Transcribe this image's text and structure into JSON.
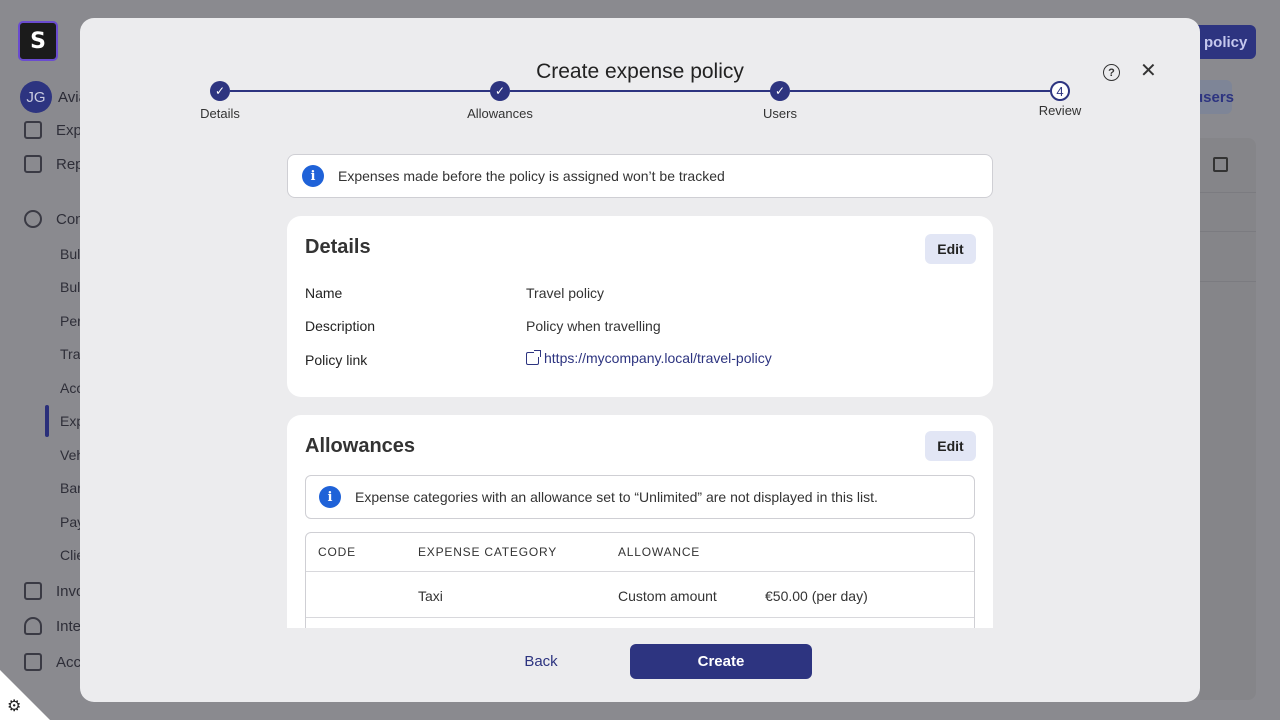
{
  "background": {
    "logo_letter": "S",
    "avatar_initials": "JG",
    "user_name": "Avia",
    "nav": [
      {
        "label": "Exp",
        "icon": "receipt-icon"
      },
      {
        "label": "Rep",
        "icon": "report-icon"
      },
      {
        "label": "Con",
        "icon": "gear-icon"
      },
      {
        "label": "Invo",
        "icon": "invoice-icon"
      },
      {
        "label": "Inte",
        "icon": "plug-icon"
      },
      {
        "label": "Acc",
        "icon": "building-icon"
      }
    ],
    "sub_nav": [
      "Bul",
      "Bul",
      "Per",
      "Tra",
      "Acc",
      "Exp",
      "Veh",
      "Bar",
      "Pay",
      "Clie"
    ],
    "top_button": "policy",
    "secondary_button": "users"
  },
  "modal": {
    "title": "Create expense policy",
    "help_symbol": "?",
    "close_symbol": "✕",
    "steps": [
      {
        "label": "Details",
        "state": "done",
        "symbol": "✓"
      },
      {
        "label": "Allowances",
        "state": "done",
        "symbol": "✓"
      },
      {
        "label": "Users",
        "state": "done",
        "symbol": "✓"
      },
      {
        "label": "Review",
        "state": "current",
        "symbol": "4"
      }
    ],
    "notice": "Expenses made before the policy is assigned won’t be tracked",
    "details": {
      "title": "Details",
      "edit_label": "Edit",
      "rows": [
        {
          "label": "Name",
          "value": "Travel policy"
        },
        {
          "label": "Description",
          "value": "Policy when travelling"
        },
        {
          "label": "Policy link",
          "value": "https://mycompany.local/travel-policy"
        }
      ]
    },
    "allowances": {
      "title": "Allowances",
      "edit_label": "Edit",
      "notice": "Expense categories with an allowance set to “Unlimited” are not displayed in this list.",
      "columns": [
        "CODE",
        "EXPENSE CATEGORY",
        "ALLOWANCE"
      ],
      "rows": [
        {
          "code": "",
          "category": "Taxi",
          "allowance_type": "Custom amount",
          "amount": "€50.00 (per day)"
        }
      ]
    },
    "footer": {
      "back_label": "Back",
      "create_label": "Create"
    }
  },
  "colors": {
    "primary": "#2d3480",
    "info": "#1f62d8",
    "edit_bg": "#e2e6f5"
  }
}
